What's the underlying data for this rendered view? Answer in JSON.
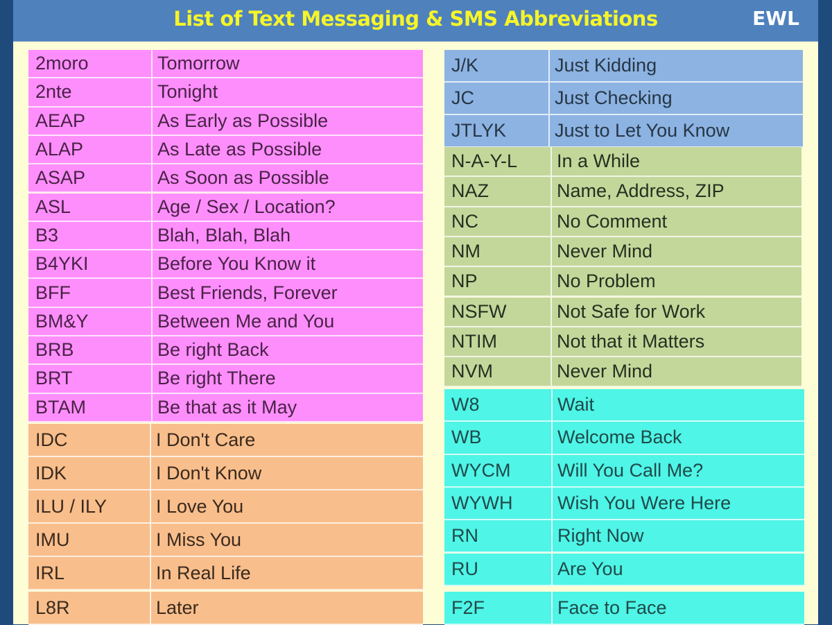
{
  "header": {
    "title": "List of Text Messaging & SMS Abbreviations",
    "brand": "EWL"
  },
  "colors": {
    "header_bg": "#4f81bd",
    "title_text": "#f5f52a",
    "frame_bg": "#fdfdd6",
    "border_dark": "#1f4a7c",
    "pink": "#fe8efc",
    "orange": "#f8be8c",
    "blue": "#8db3e2",
    "green": "#c4d79b",
    "cyan": "#4ff5e6"
  },
  "left_column": {
    "pink": [
      {
        "abbr": "2moro",
        "meaning": "Tomorrow"
      },
      {
        "abbr": "2nte",
        "meaning": "Tonight"
      },
      {
        "abbr": "AEAP",
        "meaning": "As Early as Possible"
      },
      {
        "abbr": "ALAP",
        "meaning": "As Late as Possible"
      },
      {
        "abbr": "ASAP",
        "meaning": "As Soon as Possible"
      },
      {
        "abbr": "ASL",
        "meaning": "Age / Sex / Location?"
      },
      {
        "abbr": "B3",
        "meaning": "Blah, Blah, Blah"
      },
      {
        "abbr": "B4YKI",
        "meaning": "Before You Know it"
      },
      {
        "abbr": "BFF",
        "meaning": "Best Friends, Forever"
      },
      {
        "abbr": "BM&Y",
        "meaning": "Between Me and You"
      },
      {
        "abbr": "BRB",
        "meaning": "Be right Back"
      },
      {
        "abbr": "BRT",
        "meaning": "Be right There"
      },
      {
        "abbr": "BTAM",
        "meaning": "Be that as it May"
      }
    ],
    "orange": [
      {
        "abbr": "IDC",
        "meaning": "I Don't Care"
      },
      {
        "abbr": "IDK",
        "meaning": "I Don't Know"
      },
      {
        "abbr": "ILU / ILY",
        "meaning": "I Love You"
      },
      {
        "abbr": "IMU",
        "meaning": "I Miss You"
      },
      {
        "abbr": "IRL",
        "meaning": "In Real Life"
      }
    ],
    "orange2": [
      {
        "abbr": "L8R",
        "meaning": "Later"
      }
    ]
  },
  "right_column": {
    "blue": [
      {
        "abbr": "J/K",
        "meaning": "Just Kidding"
      },
      {
        "abbr": "JC",
        "meaning": "Just Checking"
      },
      {
        "abbr": "JTLYK",
        "meaning": "Just to Let You Know"
      }
    ],
    "green": [
      {
        "abbr": "N-A-Y-L",
        "meaning": "In a While"
      },
      {
        "abbr": "NAZ",
        "meaning": "Name, Address, ZIP"
      },
      {
        "abbr": "NC",
        "meaning": "No Comment"
      },
      {
        "abbr": "NM",
        "meaning": "Never Mind"
      },
      {
        "abbr": "NP",
        "meaning": "No Problem"
      },
      {
        "abbr": "NSFW",
        "meaning": "Not Safe for Work"
      },
      {
        "abbr": "NTIM",
        "meaning": "Not that it Matters"
      },
      {
        "abbr": "NVM",
        "meaning": "Never Mind"
      }
    ],
    "cyan": [
      {
        "abbr": "W8",
        "meaning": "Wait"
      },
      {
        "abbr": "WB",
        "meaning": "Welcome Back"
      },
      {
        "abbr": "WYCM",
        "meaning": "Will You Call Me?"
      },
      {
        "abbr": "WYWH",
        "meaning": "Wish You Were Here"
      },
      {
        "abbr": "RN",
        "meaning": "Right Now"
      },
      {
        "abbr": "RU",
        "meaning": "Are You"
      }
    ],
    "cyan2": [
      {
        "abbr": "F2F",
        "meaning": "Face to Face"
      }
    ]
  }
}
